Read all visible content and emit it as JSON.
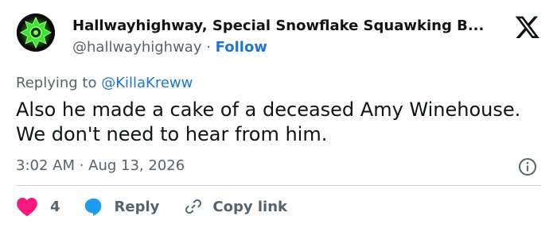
{
  "author": {
    "display_name": "Hallwayhighway, Special Snowflake Squawking B...",
    "handle": "@hallwayhighway",
    "separator": " · ",
    "follow_label": "Follow",
    "avatar_icon": "green-star-avatar",
    "accent_color": "#1d77d2"
  },
  "reply": {
    "prefix": "Replying to ",
    "to_handle": "@KillaKreww"
  },
  "tweet": {
    "text": "Also he made a cake of a deceased Amy Winehouse. We don't need to hear from him.",
    "timestamp": "3:02 AM · Aug 13, 2026"
  },
  "actions": {
    "like_count": "4",
    "reply_label": "Reply",
    "copy_label": "Copy link",
    "like_color": "#f91880",
    "reply_color": "#1d9bf0"
  }
}
